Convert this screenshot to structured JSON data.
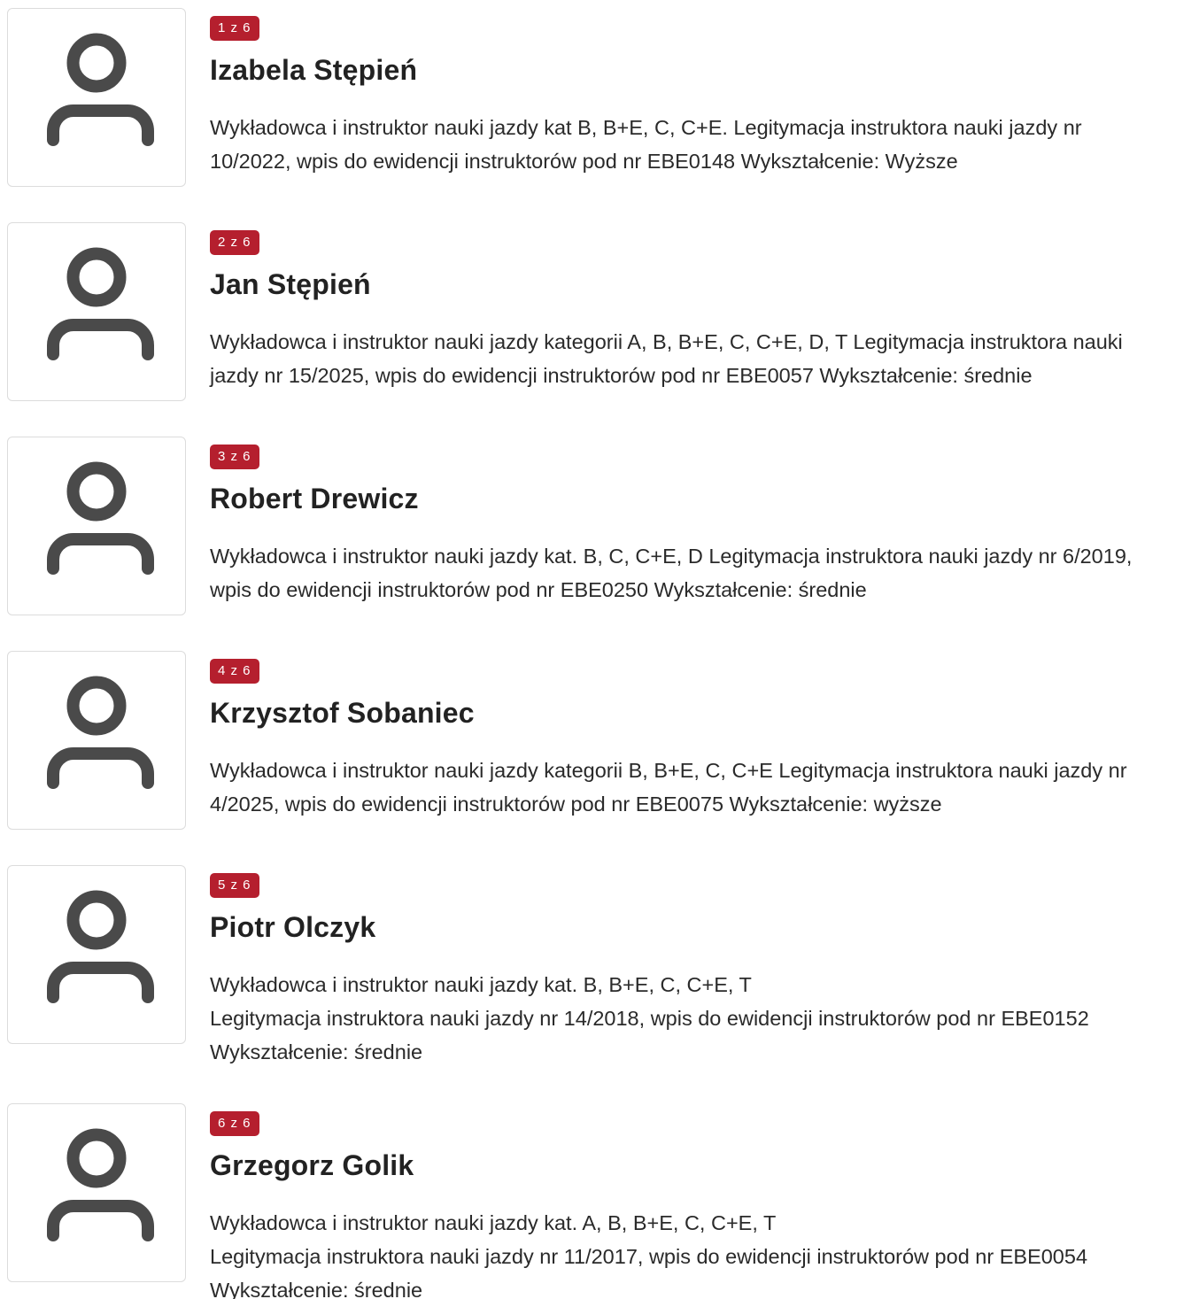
{
  "instructors": [
    {
      "badge": "1 z 6",
      "name": "Izabela Stępień",
      "lines": [
        "Wykładowca i instruktor nauki jazdy kat B, B+E, C, C+E. Legitymacja instruktora nauki jazdy nr",
        "10/2022, wpis do ewidencji instruktorów pod nr EBE0148 Wykształcenie: Wyższe"
      ],
      "avatar_icon": "user-icon"
    },
    {
      "badge": "2 z 6",
      "name": "Jan Stępień",
      "lines": [
        "Wykładowca i instruktor nauki jazdy kategorii A, B, B+E, C, C+E, D, T Legitymacja instruktora nauki",
        "jazdy nr 15/2025, wpis do ewidencji instruktorów pod nr EBE0057 Wykształcenie: średnie"
      ],
      "avatar_icon": "user-icon"
    },
    {
      "badge": "3 z 6",
      "name": "Robert Drewicz",
      "lines": [
        "Wykładowca i instruktor nauki jazdy kat. B, C, C+E, D Legitymacja instruktora nauki jazdy nr 6/2019,",
        "wpis do ewidencji instruktorów pod nr EBE0250 Wykształcenie: średnie"
      ],
      "avatar_icon": "user-icon"
    },
    {
      "badge": "4 z 6",
      "name": "Krzysztof Sobaniec",
      "lines": [
        "Wykładowca i instruktor nauki jazdy kategorii B, B+E, C, C+E Legitymacja instruktora nauki jazdy nr",
        "4/2025, wpis do ewidencji instruktorów pod nr EBE0075 Wykształcenie: wyższe"
      ],
      "avatar_icon": "user-icon"
    },
    {
      "badge": "5 z 6",
      "name": "Piotr Olczyk",
      "lines": [
        "Wykładowca i instruktor nauki jazdy kat. B, B+E, C, C+E, T",
        "Legitymacja instruktora nauki jazdy nr 14/2018, wpis do ewidencji instruktorów pod nr EBE0152",
        "Wykształcenie: średnie"
      ],
      "avatar_icon": "user-icon"
    },
    {
      "badge": "6 z 6",
      "name": "Grzegorz Golik",
      "lines": [
        "Wykładowca i instruktor nauki jazdy kat. A, B, B+E, C, C+E, T",
        "Legitymacja instruktora nauki jazdy nr 11/2017, wpis do ewidencji instruktorów pod nr EBE0054",
        "Wykształcenie: średnie"
      ],
      "avatar_icon": "user-icon"
    }
  ],
  "colors": {
    "badge_bg": "#b51f2e",
    "badge_text": "#ffffff",
    "icon": "#4a4a4a",
    "text": "#222222",
    "card_border": "#dcdcdc"
  }
}
